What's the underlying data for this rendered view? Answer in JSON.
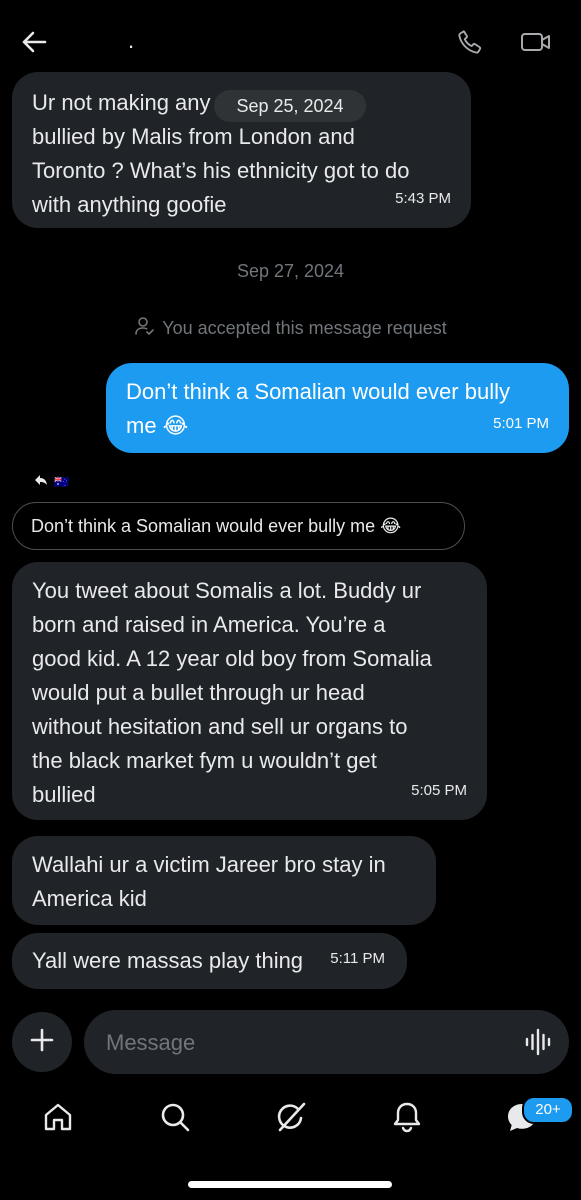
{
  "header": {
    "title": ".",
    "back_icon": "arrow-left-icon",
    "call_icon": "phone-icon",
    "video_icon": "video-camera-icon"
  },
  "messages": {
    "m1": {
      "text": "Ur not making any  get\nbullied by Malis from London and\nToronto ? What’s his ethnicity got to do\nwith anything goofie",
      "time": "5:43 PM"
    },
    "floating_date": "Sep 25, 2024",
    "date_separator": "Sep 27, 2024",
    "system_notice": "You accepted this message request",
    "m2": {
      "text": "Don’t think a Somalian would ever bully\nme 😂",
      "time": "5:01 PM"
    },
    "reply_to": {
      "flag": "🇦🇺",
      "quoted_text": "Don’t think a Somalian would ever bully me 😂"
    },
    "m3": {
      "text": "You tweet about Somalis a lot. Buddy ur\nborn and raised in America. You’re a\ngood kid. A 12 year old boy from Somalia\nwould put a bullet through ur head\nwithout hesitation and sell ur organs to\nthe black market fym u wouldn’t get\nbullied",
      "time": "5:05 PM"
    },
    "m4": {
      "text": "Wallahi ur a victim Jareer bro stay in\nAmerica kid"
    },
    "m5": {
      "text": "Yall were massas play thing",
      "time": "5:11 PM"
    }
  },
  "composer": {
    "placeholder": "Message",
    "plus_icon": "plus-icon",
    "voice_icon": "voice-waveform-icon"
  },
  "nav": {
    "items": [
      "home-icon",
      "search-icon",
      "grok-icon",
      "notifications-bell-icon",
      "messages-icon"
    ],
    "messages_badge": "20+"
  },
  "colors": {
    "accent": "#1d9bf0",
    "bubble_in": "#202327",
    "background": "#000000",
    "muted": "#71767b"
  }
}
